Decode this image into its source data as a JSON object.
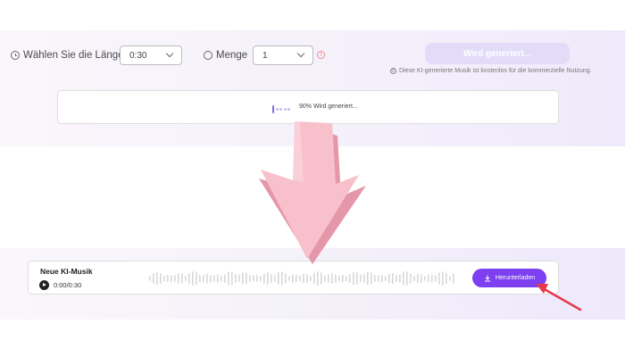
{
  "options": {
    "length_label": "Wählen Sie die Länge",
    "length_value": "0:30",
    "quantity_label": "Menge",
    "quantity_value": "1",
    "warn_glyph": "!"
  },
  "generate_button": "Wird generiert...",
  "license_note": {
    "icon_glyph": "©",
    "text": "Diese KI-generierte Musik ist kostenlos für die kommerzielle Nutzung."
  },
  "progress": {
    "text": "90% Wird generiert...",
    "percent": 90
  },
  "track": {
    "title": "Neue KI-Musik",
    "time": "0:00/0:30",
    "download_label": "Herunterladen"
  },
  "colors": {
    "accent": "#7d3ff0",
    "arrow_pink": "#f5b8c4",
    "annotation_red": "#e8394a"
  }
}
